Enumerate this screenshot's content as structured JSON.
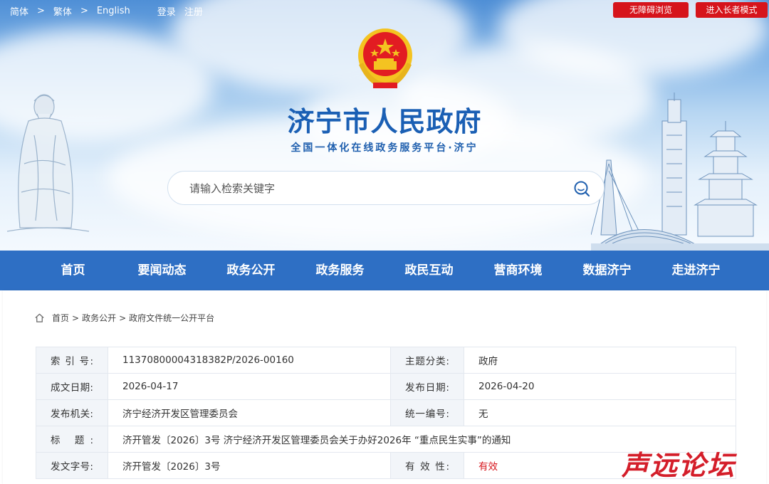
{
  "topbar": {
    "lang_simplified": "简体",
    "lang_traditional": "繁体",
    "lang_english": "English",
    "sep": ">",
    "login": "登录",
    "register": "注册",
    "accessibility_button": "无障碍浏览",
    "elderly_mode_button": "进入长者模式"
  },
  "header": {
    "title": "济宁市人民政府",
    "subtitle": "全国一体化在线政务服务平台·济宁"
  },
  "search": {
    "placeholder": "请输入检索关键字",
    "icon": "search-icon"
  },
  "nav": {
    "items": [
      "首页",
      "要闻动态",
      "政务公开",
      "政务服务",
      "政民互动",
      "营商环境",
      "数据济宁",
      "走进济宁"
    ]
  },
  "breadcrumb": {
    "icon": "home-icon",
    "items": [
      "首页",
      "政务公开",
      "政府文件统一公开平台"
    ],
    "sep": ">"
  },
  "info_table": {
    "index_label": "索 引 号:",
    "index_value": "11370800004318382P/2026-00160",
    "topic_label": "主题分类:",
    "topic_value": "政府",
    "written_date_label": "成文日期:",
    "written_date_value": "2026-04-17",
    "publish_date_label": "发布日期:",
    "publish_date_value": "2026-04-20",
    "issuer_label": "发布机关:",
    "issuer_value": "济宁经济开发区管理委员会",
    "serial_label": "统一编号:",
    "serial_value": "无",
    "title_label": "标    题:",
    "title_value": "济开管发〔2026〕3号 济宁经济开发区管理委员会关于办好2026年 “重点民生实事”的通知",
    "doc_number_label": "发文字号:",
    "doc_number_value": "济开管发〔2026〕3号",
    "validity_label": "有 效 性:",
    "validity_value": "有效"
  },
  "watermark": "声远论坛",
  "colors": {
    "primary_blue": "#2e6fc4",
    "title_blue": "#1a5fb4",
    "accent_red": "#d6141b"
  }
}
